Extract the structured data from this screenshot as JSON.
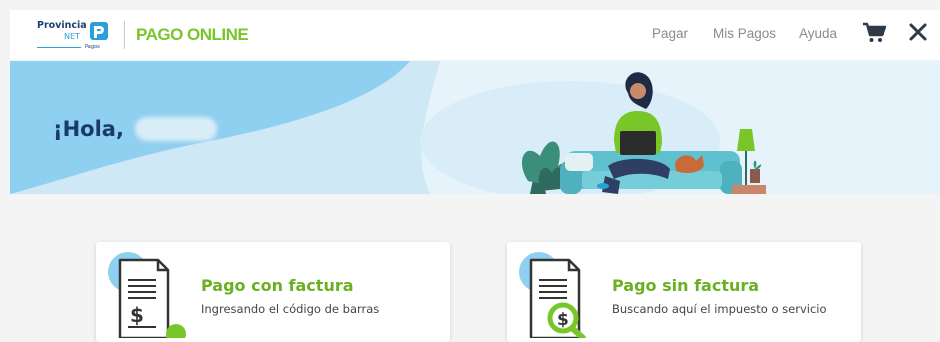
{
  "header": {
    "logo": {
      "provincia": "Provincia",
      "net": "NET",
      "pagos": "Pagos"
    },
    "brand": "PAGO ONLINE",
    "nav": {
      "pagar": "Pagar",
      "mis_pagos": "Mis Pagos",
      "ayuda": "Ayuda"
    },
    "icons": {
      "cart": "cart-icon",
      "close": "close-icon"
    }
  },
  "hero": {
    "greeting": "¡Hola,"
  },
  "cards": [
    {
      "title": "Pago con factura",
      "subtitle": "Ingresando el código de barras",
      "icon": "invoice-dollar-icon"
    },
    {
      "title": "Pago sin factura",
      "subtitle": "Buscando aquí el impuesto o servicio",
      "icon": "invoice-search-icon"
    }
  ],
  "colors": {
    "brand_green": "#79c629",
    "navy": "#1a3a6b",
    "hero_light": "#cfe8f5",
    "hero_blue": "#8fd0f0"
  }
}
